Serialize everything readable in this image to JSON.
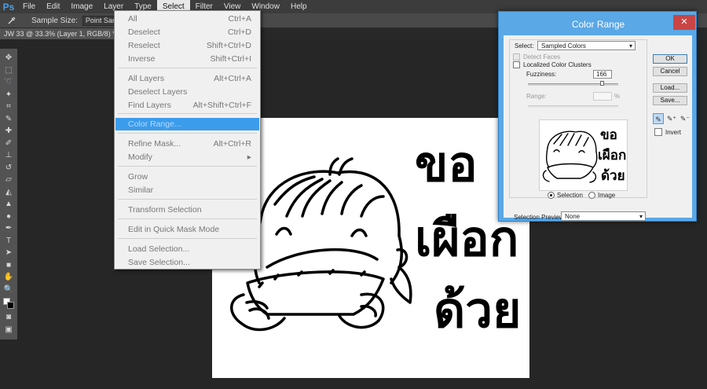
{
  "menubar": {
    "logo": "Ps",
    "items": [
      "File",
      "Edit",
      "Image",
      "Layer",
      "Type",
      "Select",
      "Filter",
      "View",
      "Window",
      "Help"
    ],
    "active": "Select"
  },
  "options_bar": {
    "sample_size_label": "Sample Size:",
    "sample_size_value": "Point Sample"
  },
  "document": {
    "tab_title": "JW 33 @ 33.3% (Layer 1, RGB/8) *",
    "tab_close": "×"
  },
  "select_menu": {
    "items": [
      {
        "label": "All",
        "shortcut": "Ctrl+A"
      },
      {
        "label": "Deselect",
        "shortcut": "Ctrl+D"
      },
      {
        "label": "Reselect",
        "shortcut": "Shift+Ctrl+D"
      },
      {
        "label": "Inverse",
        "shortcut": "Shift+Ctrl+I"
      },
      {
        "label": "All Layers",
        "shortcut": "Alt+Ctrl+A"
      },
      {
        "label": "Deselect Layers",
        "shortcut": ""
      },
      {
        "label": "Find Layers",
        "shortcut": "Alt+Shift+Ctrl+F"
      },
      {
        "label": "Color Range...",
        "shortcut": ""
      },
      {
        "label": "Refine Mask...",
        "shortcut": "Alt+Ctrl+R"
      },
      {
        "label": "Modify",
        "shortcut": "▸"
      },
      {
        "label": "Grow",
        "shortcut": ""
      },
      {
        "label": "Similar",
        "shortcut": ""
      },
      {
        "label": "Transform Selection",
        "shortcut": ""
      },
      {
        "label": "Edit in Quick Mask Mode",
        "shortcut": ""
      },
      {
        "label": "Load Selection...",
        "shortcut": ""
      },
      {
        "label": "Save Selection...",
        "shortcut": ""
      }
    ]
  },
  "color_range": {
    "title": "Color Range",
    "close": "✕",
    "select_label": "Select:",
    "select_value": "Sampled Colors",
    "detect_faces": "Detect Faces",
    "localized_clusters": "Localized Color Clusters",
    "fuzziness_label": "Fuzziness:",
    "fuzziness_value": "166",
    "fuzziness": 166,
    "fuzziness_max": 200,
    "range_label": "Range:",
    "range_unit": "%",
    "radio_selection": "Selection",
    "radio_image": "Image",
    "radio_checked": "Selection",
    "selection_preview_label": "Selection Preview:",
    "selection_preview_value": "None",
    "buttons": {
      "ok": "OK",
      "cancel": "Cancel",
      "load": "Load...",
      "save": "Save..."
    },
    "invert_label": "Invert"
  },
  "artwork": {
    "line1": "ขอ",
    "line2": "เผือก",
    "line3": "ด้วย"
  },
  "colors": {
    "menu_highlight": "#3c9cec",
    "dialog_frame": "#5aa8e6",
    "close_button": "#c94545",
    "ps_blue": "#4aa0e8"
  },
  "icons": [
    "eyedropper-icon",
    "move-icon",
    "marquee-icon",
    "lasso-icon",
    "magic-wand-icon",
    "crop-icon",
    "brush-icon",
    "hand-icon",
    "zoom-icon"
  ]
}
